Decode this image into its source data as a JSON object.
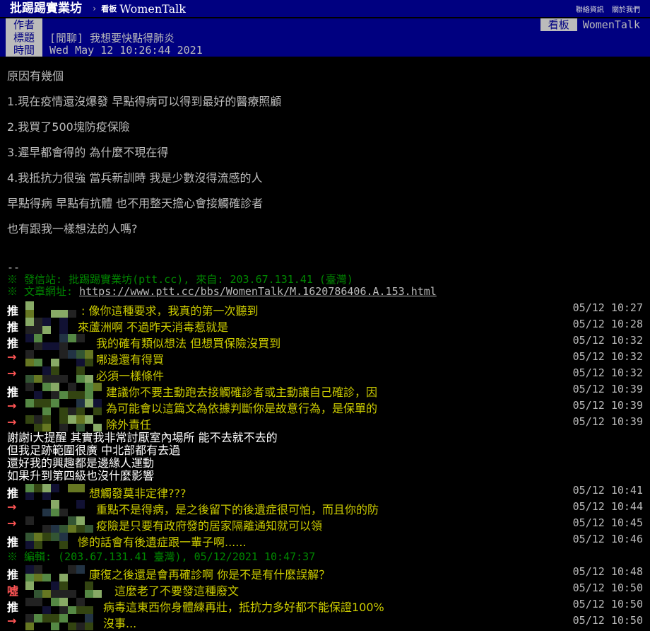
{
  "topbar": {
    "site": "批踢踢實業坊",
    "sep": "›",
    "board_prefix": "看板",
    "board": "WomenTalk",
    "links": [
      "聯絡資訊",
      "關於我們"
    ]
  },
  "meta": {
    "author_label": "作者",
    "author": "",
    "board_label": "看板",
    "board": "WomenTalk",
    "title_label": "標題",
    "title": "[閒聊] 我想要快點得肺炎",
    "time_label": "時間",
    "time": "Wed May 12 10:26:44 2021"
  },
  "body": [
    "原因有幾個",
    "1.現在疫情還沒爆發 早點得病可以得到最好的醫療照顧",
    "2.我買了500塊防疫保險",
    "3.遲早都會得的 為什麼不現在得",
    "4.我抵抗力很強 當兵新訓時 我是少數沒得流感的人",
    "早點得病 早點有抗體 也不用整天擔心會接觸確診者",
    "也有跟我一樣想法的人嗎?"
  ],
  "signature": {
    "dashes": "--",
    "source": "※ 發信站: 批踢踢實業坊(ptt.cc), 來自: 203.67.131.41 (臺灣)",
    "url_label": "※ 文章網址: ",
    "url": "https://www.ptt.cc/bbs/WomenTalk/M.1620786406.A.153.html"
  },
  "pushes": [
    {
      "tag": "推",
      "kind": "push",
      "text": ": 像你這種要求，我真的第一次聽到",
      "time": "05/12 10:27"
    },
    {
      "tag": "推",
      "kind": "push",
      "text": "來蘆洲啊 不過昨天消毒惹就是",
      "time": "05/12 10:28"
    },
    {
      "tag": "推",
      "kind": "push",
      "text": "我的確有類似想法 但想買保險沒買到",
      "time": "05/12 10:32"
    },
    {
      "tag": "→",
      "kind": "arrow",
      "text": "哪邊還有得買",
      "time": "05/12 10:32"
    },
    {
      "tag": "→",
      "kind": "arrow",
      "text": "必須一樣條件",
      "time": "05/12 10:32"
    },
    {
      "tag": "推",
      "kind": "push",
      "text": "建議你不要主動跑去接觸確診者或主動讓自己確診，因",
      "time": "05/12 10:39"
    },
    {
      "tag": "→",
      "kind": "arrow",
      "text": "為可能會以這篇文為依據判斷你是故意行為，是保單的",
      "time": "05/12 10:39"
    },
    {
      "tag": "→",
      "kind": "arrow",
      "text": "除外責任",
      "time": "05/12 10:39"
    }
  ],
  "reply_lines": [
    "謝謝i大提醒 其實我非常討厭室內場所 能不去就不去的",
    "但我足跡範圍很廣 中北部都有去過",
    "還好我的興趣都是邊緣人運動",
    "如果升到第四級也沒什麼影響"
  ],
  "pushes2": [
    {
      "tag": "推",
      "kind": "push",
      "text": "想觸發莫非定律???",
      "time": "05/12 10:41"
    },
    {
      "tag": "→",
      "kind": "arrow",
      "text": "重點不是得病，是之後留下的後遺症很可怕，而且你的防",
      "time": "05/12 10:44"
    },
    {
      "tag": "→",
      "kind": "arrow",
      "text": "疫險是只要有政府發的居家隔離通知就可以領",
      "time": "05/12 10:45"
    },
    {
      "tag": "推",
      "kind": "push",
      "text": "慘的話會有後遺症跟一輩子啊......",
      "time": "05/12 10:46"
    }
  ],
  "edit_line": "※ 編輯:          (203.67.131.41 臺灣), 05/12/2021 10:47:37",
  "pushes3": [
    {
      "tag": "推",
      "kind": "push",
      "text": "康復之後還是會再確診啊 你是不是有什麼誤解？",
      "time": "05/12 10:48"
    },
    {
      "tag": "噓",
      "kind": "boo",
      "text": "這麼老了不要發這種廢文",
      "time": "05/12 10:50"
    },
    {
      "tag": "推",
      "kind": "push",
      "text": "病毒這東西你身體練再壯，抵抗力多好都不能保證100%",
      "time": "05/12 10:50"
    },
    {
      "tag": "→",
      "kind": "arrow",
      "text": "沒事...",
      "time": "05/12 10:50"
    }
  ]
}
